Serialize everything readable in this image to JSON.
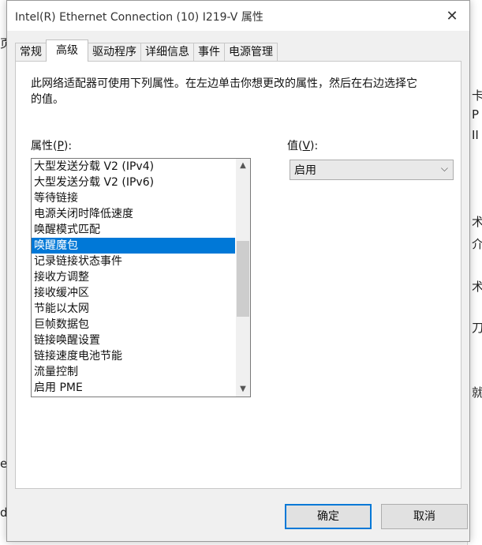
{
  "background": {
    "left_fragments": [
      "页",
      "e",
      "d"
    ],
    "right_fragments": [
      "卡",
      "P",
      "II",
      "术",
      "介",
      "术",
      "刀",
      "就"
    ]
  },
  "dialog": {
    "title": "Intel(R) Ethernet Connection (10) I219-V 属性",
    "close_glyph": "✕",
    "tabs": [
      {
        "label": "常规",
        "active": false
      },
      {
        "label": "高级",
        "active": true
      },
      {
        "label": "驱动程序",
        "active": false
      },
      {
        "label": "详细信息",
        "active": false
      },
      {
        "label": "事件",
        "active": false
      },
      {
        "label": "电源管理",
        "active": false
      }
    ],
    "description": "此网络适配器可使用下列属性。在左边单击你想更改的属性，然后在右边选择它的值。",
    "property_label": "属性",
    "property_hotkey": "P",
    "value_label": "值",
    "value_hotkey": "V",
    "properties": [
      "大型发送分载 V2 (IPv4)",
      "大型发送分载 V2 (IPv6)",
      "等待链接",
      "电源关闭时降低速度",
      "唤醒模式匹配",
      "唤醒魔包",
      "记录链接状态事件",
      "接收方调整",
      "接收缓冲区",
      "节能以太网",
      "巨帧数据包",
      "链接唤醒设置",
      "链接速度电池节能",
      "流量控制",
      "启用 PME"
    ],
    "selected_property": "唤醒魔包",
    "value_selected": "启用",
    "scroll_up_glyph": "▲",
    "scroll_down_glyph": "▼",
    "dropdown_glyph": "⌵",
    "ok_label": "确定",
    "cancel_label": "取消"
  },
  "colors": {
    "selection": "#0078d7",
    "dialog_bg": "#f0f0f0",
    "panel_bg": "#ffffff"
  }
}
